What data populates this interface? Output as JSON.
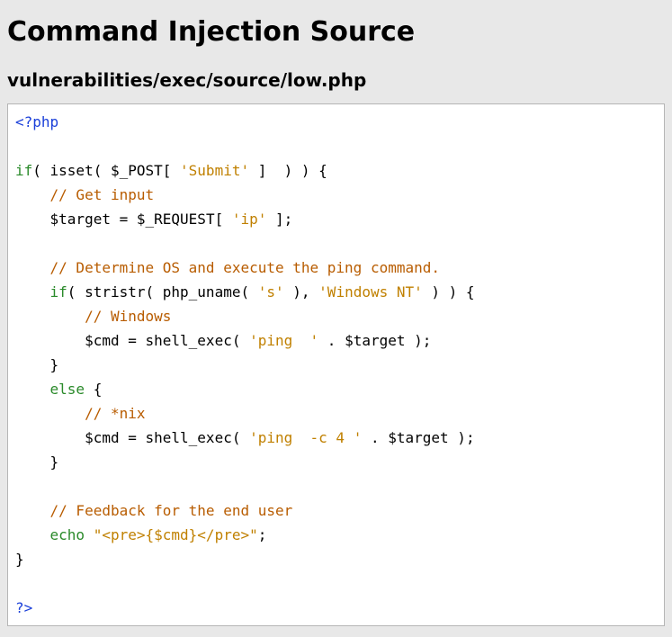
{
  "title": "Command Injection Source",
  "subtitle": "vulnerabilities/exec/source/low.php",
  "code": {
    "open_tag": "<?php",
    "kw_if1": "if",
    "fn_isset": "isset",
    "var_post": "$_POST",
    "str_submit": "'Submit'",
    "com_get_input": "// Get input",
    "var_target1": "$target",
    "var_request": "$_REQUEST",
    "str_ip": "'ip'",
    "com_determine": "// Determine OS and execute the ping command.",
    "kw_if2": "if",
    "fn_stristr": "stristr",
    "fn_uname": "php_uname",
    "str_s": "'s'",
    "str_winnt": "'Windows NT'",
    "com_windows": "// Windows",
    "var_cmd1": "$cmd",
    "fn_shell1": "shell_exec",
    "str_ping1": "'ping  '",
    "var_target2": "$target",
    "kw_else": "else",
    "com_nix": "// *nix",
    "var_cmd2": "$cmd",
    "fn_shell2": "shell_exec",
    "str_ping2": "'ping  -c 4 '",
    "var_target3": "$target",
    "com_feedback": "// Feedback for the end user",
    "kw_echo": "echo",
    "str_echo": "\"<pre>{$cmd}</pre>\"",
    "close_tag": "?>"
  }
}
